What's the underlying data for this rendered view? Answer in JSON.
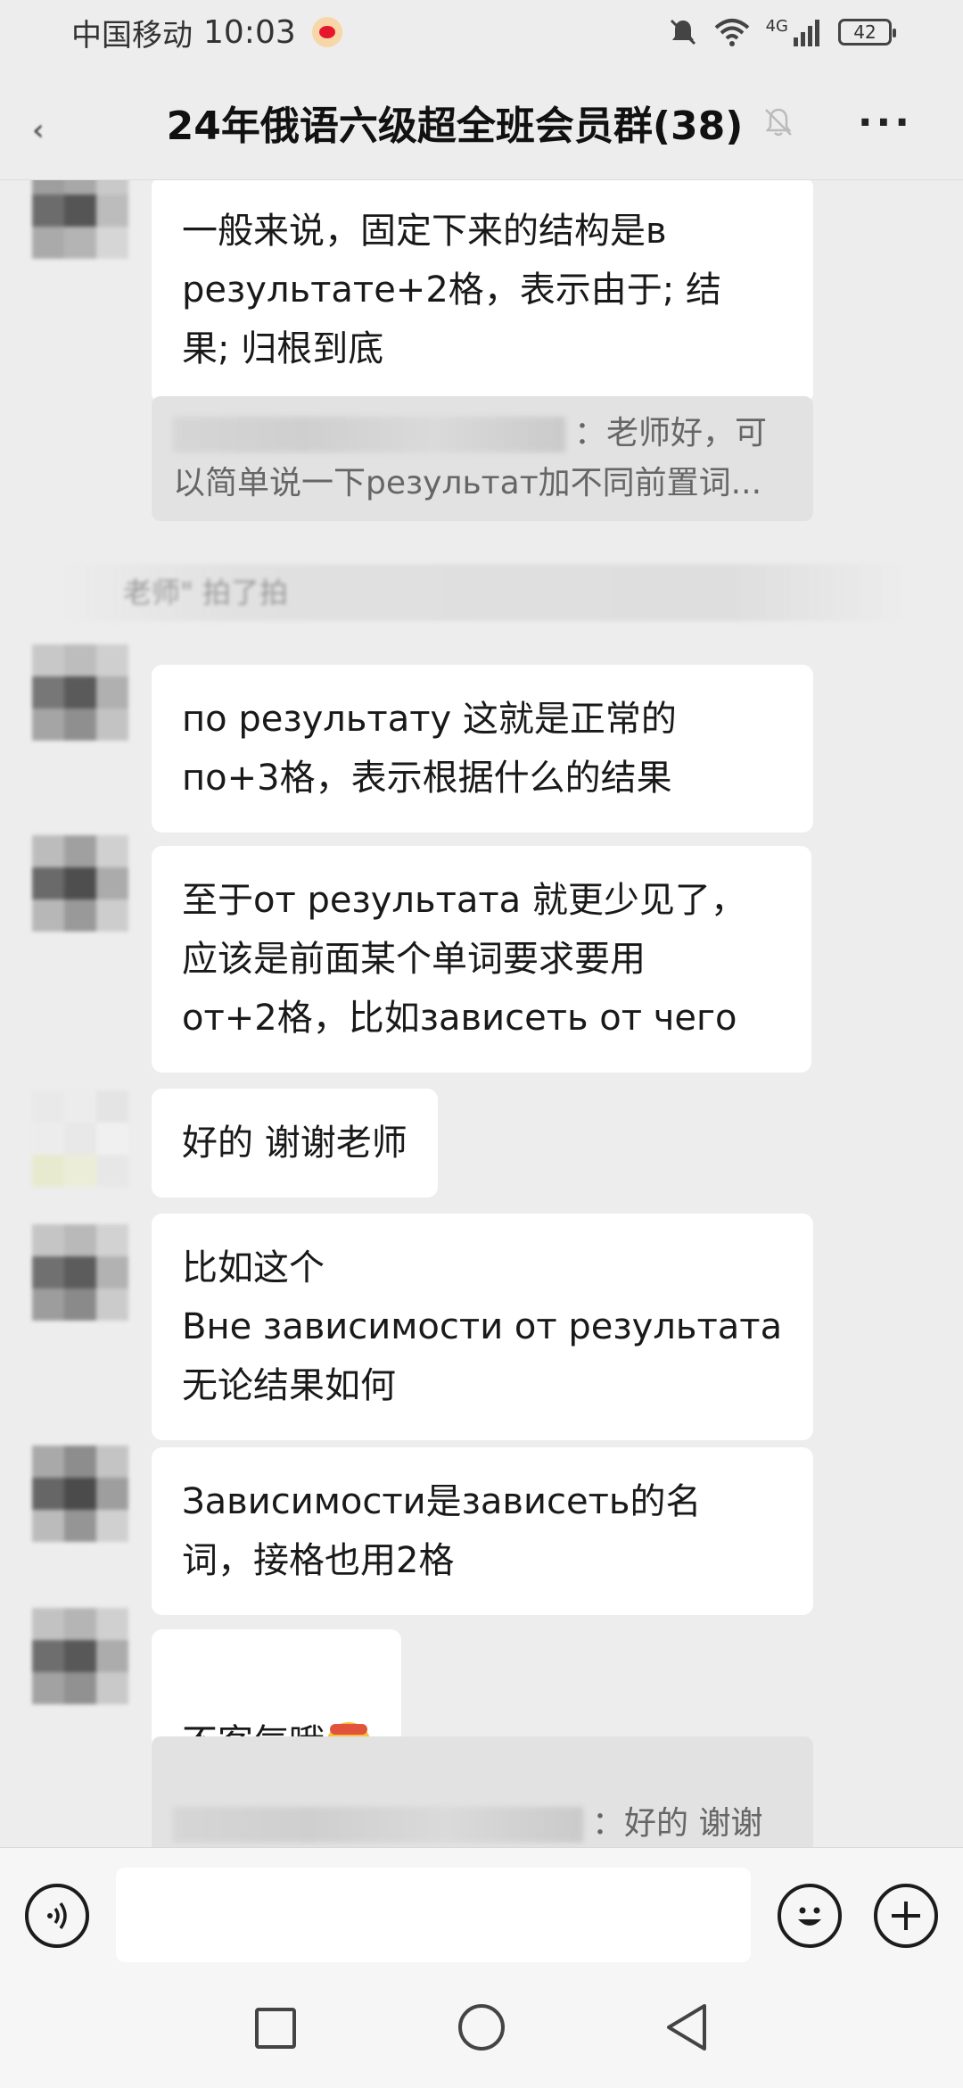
{
  "status_bar": {
    "carrier": "中国移动",
    "time": "10:03",
    "network": "4G",
    "battery": "42"
  },
  "header": {
    "title": "24年俄语六级超全班会员群(38)",
    "back_icon": "chevron-left-icon",
    "mute_icon": "bell-off-icon",
    "more_icon": "more-icon"
  },
  "messages": [
    {
      "type": "text",
      "text": "一般来说，固定下来的结构是в\nрезультате+2格，表示由于; 结\n果; 归根到底"
    },
    {
      "type": "quote",
      "text": "：老师好，可以简单说一下результат加不同前置词..."
    },
    {
      "type": "system",
      "text": "老师\" 拍了拍"
    },
    {
      "type": "text",
      "text": "по результату 这就是正常的\nпо+3格，表示根据什么的结果"
    },
    {
      "type": "text",
      "text": "至于от результата 就更少见了，\n应该是前面某个单词要求要用\nот+2格，比如зависеть от чего"
    },
    {
      "type": "text",
      "text": "好的 谢谢老师"
    },
    {
      "type": "text",
      "text": "比如这个\nВне зависимости от результата\n无论结果如何"
    },
    {
      "type": "text",
      "text": "Зависимости是зависеть的名\n词，接格也用2格"
    },
    {
      "type": "text",
      "text": "不客气哦"
    },
    {
      "type": "quote",
      "text": "：好的 谢谢\n老师"
    }
  ],
  "input_bar": {
    "voice_icon": "voice-icon",
    "emoji_icon": "emoji-icon",
    "plus_icon": "plus-icon",
    "placeholder": ""
  },
  "nav_bar": {
    "recent_icon": "square-icon",
    "home_icon": "circle-icon",
    "back_icon": "triangle-back-icon"
  }
}
